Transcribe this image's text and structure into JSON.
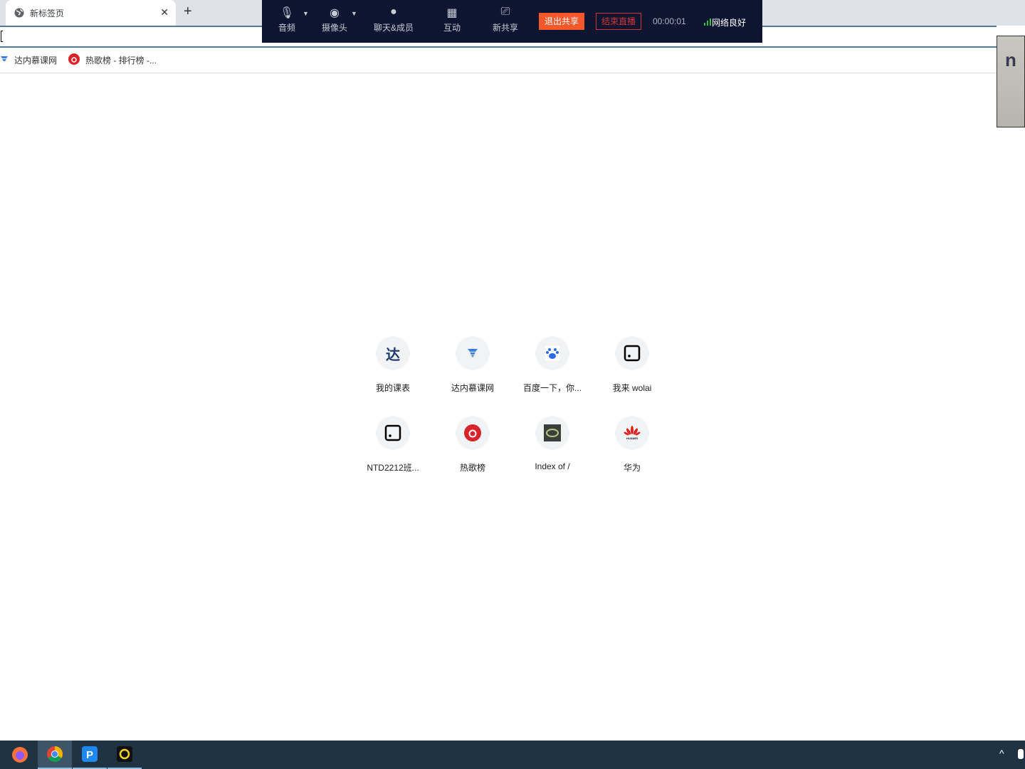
{
  "browser": {
    "tab_title": "新标签页",
    "tab_icon": "globe-icon",
    "close_glyph": "✕",
    "newtab_glyph": "+"
  },
  "bookmarks": [
    {
      "label": "达内慕课网",
      "icon": "tedu-icon"
    },
    {
      "label": "热歌榜 - 排行榜 -...",
      "icon": "netease-music-icon"
    }
  ],
  "meeting": {
    "buttons": [
      {
        "label": "音频",
        "icon": "microphone-icon"
      },
      {
        "label": "摄像头",
        "icon": "camera-icon"
      },
      {
        "label": "聊天&成员",
        "icon": "person-icon"
      },
      {
        "label": "互动",
        "icon": "grid-icon"
      },
      {
        "label": "新共享",
        "icon": "screen-share-icon"
      }
    ],
    "exit_share": "退出共享",
    "end_live": "结束直播",
    "timer": "00:00:01",
    "network": "网络良好",
    "colors": {
      "bg": "#0d1530",
      "exit": "#f5582a",
      "end": "#d3353a",
      "signal": "#3fbf3f"
    }
  },
  "shortcuts": [
    {
      "label": "我的课表",
      "icon": "da-icon"
    },
    {
      "label": "达内慕课网",
      "icon": "tedu-icon"
    },
    {
      "label": "百度一下，你...",
      "icon": "baidu-icon"
    },
    {
      "label": "我来 wolai",
      "icon": "wolai-icon"
    },
    {
      "label": "NTD2212班...",
      "icon": "wolai-icon"
    },
    {
      "label": "热歌榜",
      "icon": "netease-music-icon"
    },
    {
      "label": "Index of /",
      "icon": "index-icon"
    },
    {
      "label": "华为",
      "icon": "huawei-icon",
      "icon_text": "HUAWEI"
    }
  ],
  "taskbar": [
    {
      "name": "firefox"
    },
    {
      "name": "chrome"
    },
    {
      "name": "p-app"
    },
    {
      "name": "circle-app"
    }
  ],
  "tray": {
    "chevron": "^"
  }
}
